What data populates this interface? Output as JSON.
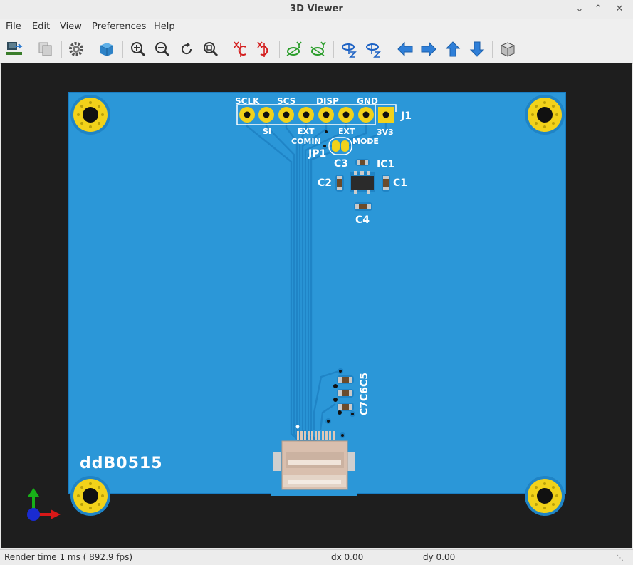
{
  "window": {
    "title": "3D Viewer"
  },
  "menu": [
    "File",
    "Edit",
    "View",
    "Preferences",
    "Help"
  ],
  "toolbar": [
    {
      "name": "reload-board-button",
      "icon": "reload-board-icon"
    },
    {
      "name": "copy-image-button",
      "icon": "copy-icon"
    },
    {
      "name": "options-button",
      "icon": "gear-icon"
    },
    {
      "name": "raytracing-button",
      "icon": "cube-icon"
    },
    {
      "name": "zoom-in-button",
      "icon": "zoom-in-icon"
    },
    {
      "name": "zoom-out-button",
      "icon": "zoom-out-icon"
    },
    {
      "name": "redraw-button",
      "icon": "redraw-icon"
    },
    {
      "name": "zoom-fit-button",
      "icon": "zoom-fit-icon"
    },
    {
      "name": "rotate-x-cw-button",
      "icon": "rotate-x-icon"
    },
    {
      "name": "rotate-x-ccw-button",
      "icon": "rotate-x-icon"
    },
    {
      "name": "rotate-y-cw-button",
      "icon": "rotate-y-icon"
    },
    {
      "name": "rotate-y-ccw-button",
      "icon": "rotate-y-icon"
    },
    {
      "name": "rotate-z-cw-button",
      "icon": "rotate-z-icon"
    },
    {
      "name": "rotate-z-ccw-button",
      "icon": "rotate-z-icon"
    },
    {
      "name": "move-left-button",
      "icon": "arrow-left-icon"
    },
    {
      "name": "move-right-button",
      "icon": "arrow-right-icon"
    },
    {
      "name": "move-up-button",
      "icon": "arrow-up-icon"
    },
    {
      "name": "move-down-button",
      "icon": "arrow-down-icon"
    },
    {
      "name": "toggle-ortho-button",
      "icon": "ortho-cube-icon"
    }
  ],
  "board": {
    "connector_labels_top": [
      "SCLK",
      "SCS",
      "DISP",
      "GND"
    ],
    "connector_labels_bottom": [
      "SI",
      "EXT",
      "EXT",
      "3V3"
    ],
    "jumper_labels": [
      "COMIN",
      "MODE"
    ],
    "refs": {
      "j1": "J1",
      "jp1": "JP1",
      "c3": "C3",
      "ic1": "IC1",
      "c2": "C2",
      "c1": "C1",
      "c4": "C4",
      "c7c6c5": "C7C6C5"
    },
    "board_name": "ddB0515"
  },
  "colors": {
    "pcb": "#2b97d8",
    "pcb_edge": "#1a7ec3",
    "pad": "#f2d21a",
    "silk": "#ffffff",
    "background": "#1e1e1e"
  },
  "status": {
    "render": "Render time 1 ms ( 892.9 fps)",
    "dx": "dx 0.00",
    "dy": "dy 0.00"
  }
}
